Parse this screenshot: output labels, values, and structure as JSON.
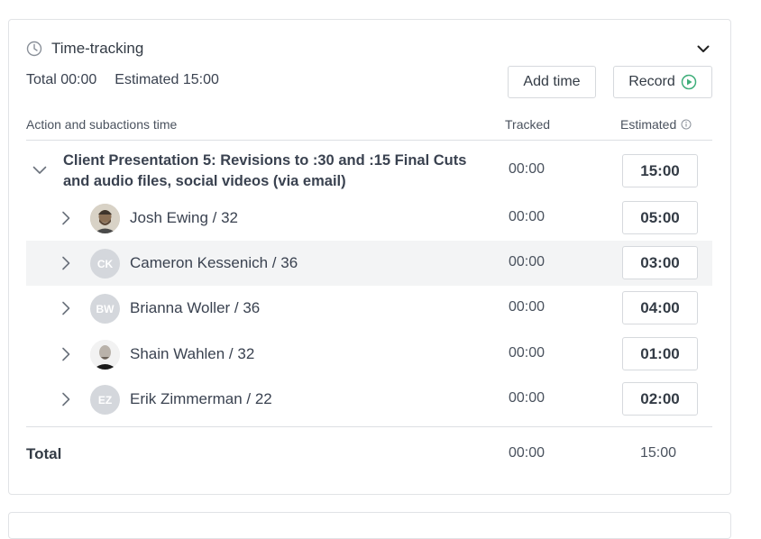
{
  "section": {
    "title": "Time-tracking",
    "total_label": "Total 00:00",
    "estimated_label": "Estimated 15:00",
    "add_time_label": "Add time",
    "record_label": "Record"
  },
  "table": {
    "headers": {
      "action": "Action and subactions time",
      "tracked": "Tracked",
      "estimated": "Estimated"
    },
    "task": {
      "name": "Client Presentation 5: Revisions to :30 and :15 Final Cuts and audio files, social videos (via email)",
      "tracked": "00:00",
      "estimated": "15:00"
    },
    "people": [
      {
        "name": "Josh Ewing / 32",
        "initials": "",
        "tracked": "00:00",
        "estimated": "05:00"
      },
      {
        "name": "Cameron Kessenich / 36",
        "initials": "CK",
        "tracked": "00:00",
        "estimated": "03:00"
      },
      {
        "name": "Brianna Woller / 36",
        "initials": "BW",
        "tracked": "00:00",
        "estimated": "04:00"
      },
      {
        "name": "Shain Wahlen / 32",
        "initials": "",
        "tracked": "00:00",
        "estimated": "01:00"
      },
      {
        "name": "Erik Zimmerman / 22",
        "initials": "EZ",
        "tracked": "00:00",
        "estimated": "02:00"
      }
    ],
    "total": {
      "label": "Total",
      "tracked": "00:00",
      "estimated": "15:00"
    }
  },
  "colors": {
    "accent_green": "#3fae7a",
    "highlight_row": "#f3f4f5",
    "border": "#dcdfe3"
  }
}
